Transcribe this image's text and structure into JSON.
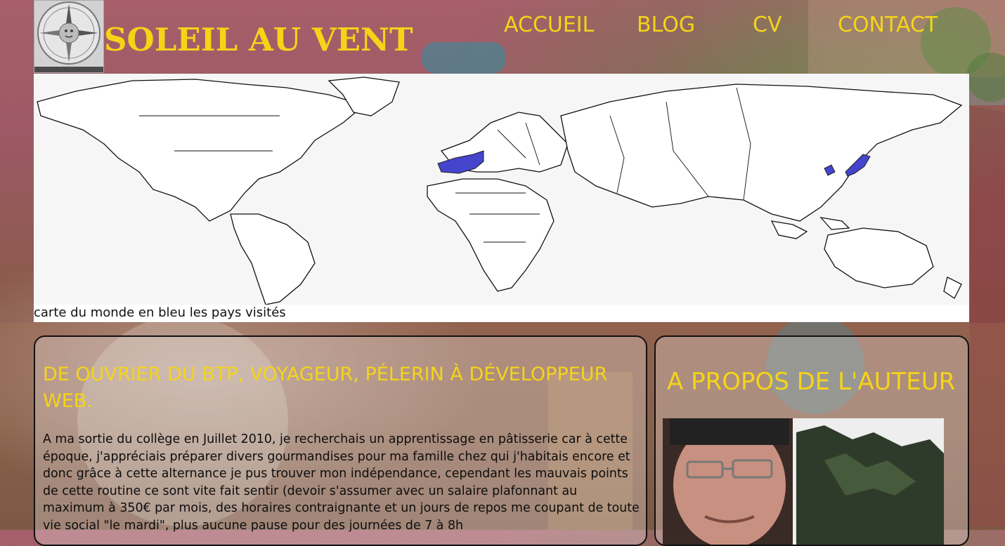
{
  "header": {
    "site_title": "SOLEIL AU VENT",
    "logo_name": "compass-rose-logo"
  },
  "nav": {
    "items": [
      {
        "label": "ACCUEIL"
      },
      {
        "label": "BLOG"
      },
      {
        "label": "CV"
      },
      {
        "label": "CONTACT"
      }
    ]
  },
  "map": {
    "caption": "carte du monde en bleu les pays visités",
    "highlight_color": "#4444cc",
    "visited_regions": [
      "western-europe",
      "japan-korea"
    ]
  },
  "article": {
    "title": "De ouvrier du BTP, voyageur, pélerin à développeur web.",
    "body": "A ma sortie du collège en Juillet 2010, je recherchais un apprentissage en pâtisserie car à cette époque, j'appréciais préparer divers gourmandises pour ma famille chez qui j'habitais encore et donc grâce à cette alternance je pus trouver mon indépendance, cependant les mauvais points de cette routine ce sont vite fait sentir (devoir s'assumer avec un salaire plafonnant au maximum à 350€ par mois, des horaires contraignante et un jours de repos me coupant de toute vie social \"le mardi\", plus aucune pause pour des journées de 7 à 8h"
  },
  "sidebar": {
    "title": "A propos de l'auteur",
    "photo_name": "author-photo"
  },
  "colors": {
    "accent": "#f5d418",
    "card_border": "#111111"
  }
}
